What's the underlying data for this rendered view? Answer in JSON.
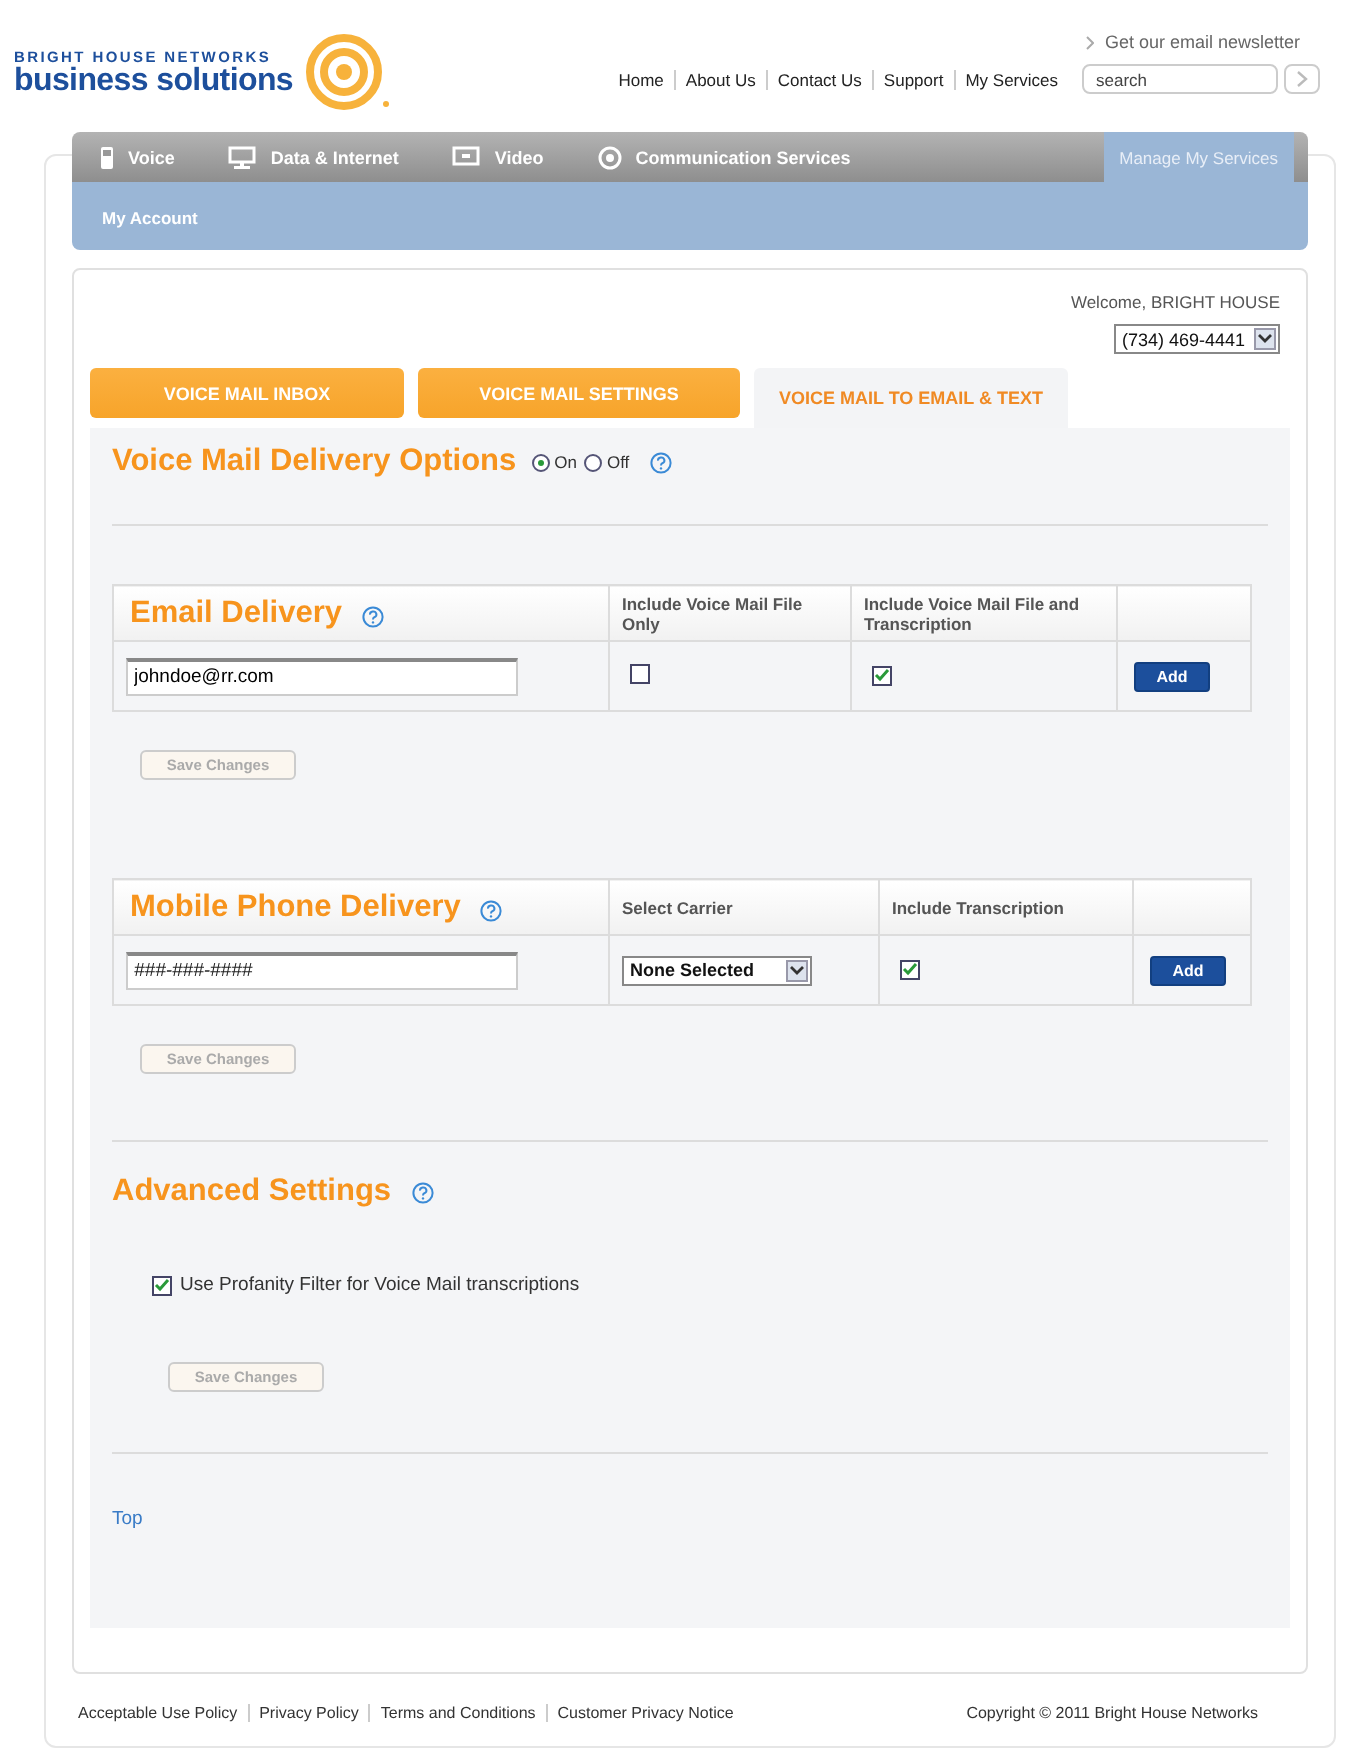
{
  "header": {
    "logo_line1": "BRIGHT HOUSE NETWORKS",
    "logo_line2": "business solutions",
    "newsletter": "Get our email newsletter",
    "links": [
      "Home",
      "About Us",
      "Contact Us",
      "Support",
      "My Services"
    ],
    "search": {
      "placeholder": "search"
    }
  },
  "main_nav": [
    {
      "label": "Voice",
      "selected": false
    },
    {
      "label": "Data & Internet",
      "selected": false
    },
    {
      "label": "Video",
      "selected": false
    },
    {
      "label": "Communication Services",
      "selected": false
    },
    {
      "label": "Manage My Services",
      "selected": true
    }
  ],
  "sub_nav": [
    "My Account"
  ],
  "account": {
    "welcome": "Welcome, BRIGHT HOUSE",
    "phone": "(734) 469-4441"
  },
  "tabs": [
    {
      "label": "VOICE MAIL INBOX",
      "selected": false
    },
    {
      "label": "VOICE MAIL SETTINGS",
      "selected": false
    },
    {
      "label": "VOICE MAIL TO EMAIL & TEXT",
      "selected": true
    }
  ],
  "delivery_options": {
    "title": "Voice Mail Delivery Options",
    "radios": [
      {
        "label": "On",
        "selected": true
      },
      {
        "label": "Off",
        "selected": false
      }
    ]
  },
  "email_delivery": {
    "title": "Email Delivery",
    "columns": [
      "Include Voice Mail File Only",
      "Include Voice Mail File and Transcription"
    ],
    "value": "johndoe@rr.com",
    "file_only": false,
    "file_and_transcription": true,
    "add_button": "Add",
    "save_button": {
      "label": "Save Changes",
      "disabled": true
    }
  },
  "mobile_delivery": {
    "title": "Mobile Phone Delivery",
    "columns": [
      "Select Carrier",
      "Include Transcription"
    ],
    "placeholder": "###-###-####",
    "carrier": "None Selected",
    "transcription": true,
    "add_button": "Add",
    "save_button": {
      "label": "Save Changes",
      "disabled": true
    }
  },
  "advanced": {
    "title": "Advanced Settings",
    "options": [
      {
        "label": "Use Profanity Filter for Voice Mail transcriptions",
        "checked": true
      }
    ],
    "save_button": {
      "label": "Save Changes",
      "disabled": true
    }
  },
  "top_link": "Top",
  "footer": {
    "links": [
      "Acceptable Use Policy",
      "Privacy Policy",
      "Terms and Conditions",
      "Customer Privacy Notice"
    ],
    "copyright": "Copyright © 2011 Bright House Networks"
  }
}
